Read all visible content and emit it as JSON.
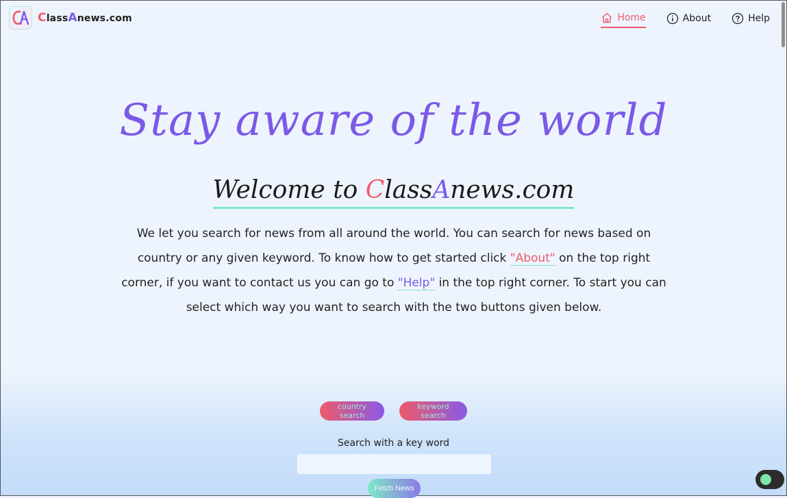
{
  "brand": {
    "logo_letters": "CA",
    "name_c": "C",
    "name_part1": "lass",
    "name_a": "A",
    "name_part2": "news.com"
  },
  "nav": {
    "items": [
      {
        "label": "Home",
        "icon": "home-icon",
        "active": true
      },
      {
        "label": "About",
        "icon": "info-icon",
        "active": false
      },
      {
        "label": "Help",
        "icon": "help-icon",
        "active": false
      }
    ]
  },
  "hero": {
    "title": "Stay aware of the world",
    "welcome_prefix": "Welcome to ",
    "welcome_c": "C",
    "welcome_mid": "lass",
    "welcome_a": "A",
    "welcome_suffix": "news.com"
  },
  "description": {
    "part1": "We let you search for news from all around the world. You can search for news based on country or any given keyword. To know how to get started click ",
    "about_link": "\"About\"",
    "part2": " on the top right corner, if you want to contact us you can go to ",
    "help_link": "\"Help\"",
    "part3": " in the top right corner. To start you can select which way you want to search with the two buttons given below."
  },
  "search": {
    "country_button": "country search",
    "keyword_button": "keyword search",
    "label": "Search with a key word",
    "input_value": "",
    "fetch_button": "Fetch News"
  },
  "colors": {
    "accent_red": "#ef5a6a",
    "accent_purple": "#7b5ae6",
    "accent_mint": "#7ee8c6",
    "toggle_knob": "#7ee8a8"
  }
}
